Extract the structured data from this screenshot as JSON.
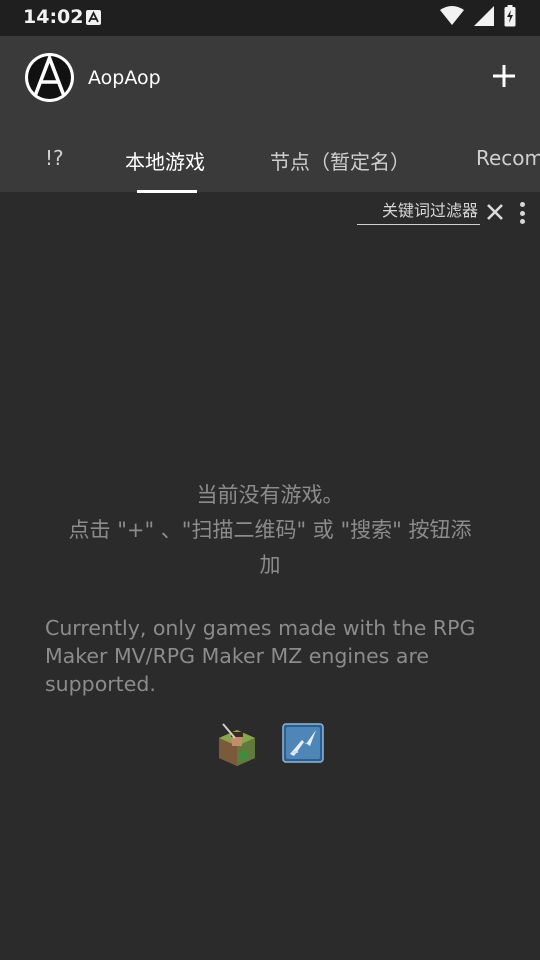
{
  "status_bar": {
    "time": "14:02",
    "icons": [
      "accessibility-a-icon",
      "wifi-icon",
      "signal-icon",
      "battery-charging-icon"
    ]
  },
  "app_bar": {
    "title": "AopAop",
    "logo_letter": "A",
    "add_icon": "plus-icon"
  },
  "tabs": [
    {
      "label": "!?",
      "active": false
    },
    {
      "label": "本地游戏",
      "active": true
    },
    {
      "label": "节点（暂定名）",
      "active": false
    },
    {
      "label": "Recom",
      "active": false
    }
  ],
  "filter": {
    "placeholder": "关键词过滤器",
    "clear_icon": "close-icon",
    "menu_icon": "more-vert-icon"
  },
  "empty_state": {
    "message_line1": "当前没有游戏。",
    "message_line2": "点击 \"+\" 、\"扫描二维码\" 或 \"搜索\" 按钮添",
    "message_line3": "加",
    "supported_line1": "Currently, only games made with the RPG",
    "supported_line2": "Maker MV/RPG Maker MZ engines are",
    "supported_line3": "supported.",
    "engine_icons": [
      "rpg-maker-mv-icon",
      "rpg-maker-mz-icon"
    ]
  },
  "colors": {
    "background": "#2b2b2b",
    "app_bar": "#3a3a3a",
    "status_bar": "#1f1f1f",
    "muted_text": "#8c8c8c"
  }
}
